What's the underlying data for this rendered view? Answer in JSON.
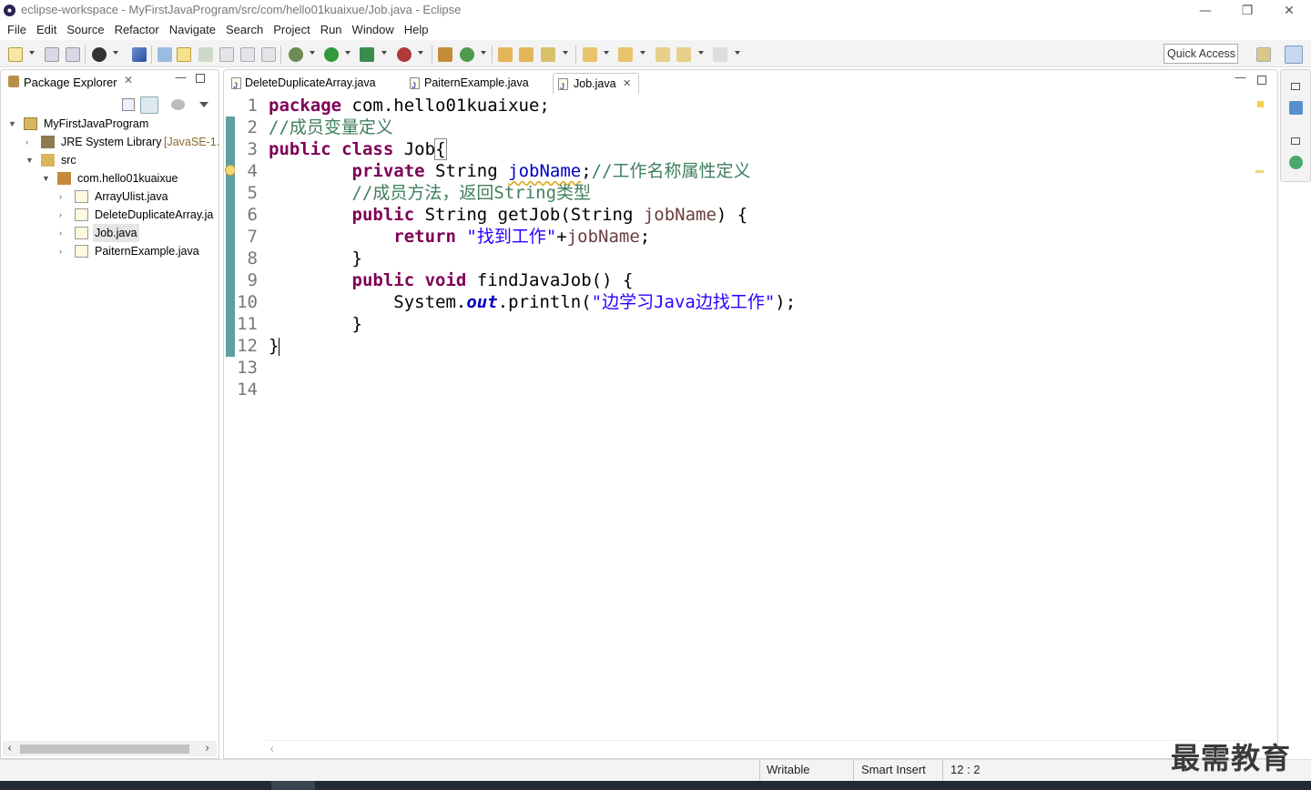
{
  "window": {
    "title": "eclipse-workspace - MyFirstJavaProgram/src/com/hello01kuaixue/Job.java - Eclipse",
    "minimize": "—",
    "restore": "❐",
    "close": "✕"
  },
  "menu": [
    "File",
    "Edit",
    "Source",
    "Refactor",
    "Navigate",
    "Search",
    "Project",
    "Run",
    "Window",
    "Help"
  ],
  "toolbar": {
    "quick_access": "Quick Access"
  },
  "package_explorer": {
    "title": "Package Explorer",
    "tree": [
      {
        "label": "MyFirstJavaProgram",
        "extra": ""
      },
      {
        "label": "JRE System Library",
        "extra": "[JavaSE-1."
      },
      {
        "label": "src",
        "extra": ""
      },
      {
        "label": "com.hello01kuaixue",
        "extra": ""
      },
      {
        "label": "ArrayUlist.java",
        "extra": ""
      },
      {
        "label": "DeleteDuplicateArray.ja",
        "extra": ""
      },
      {
        "label": "Job.java",
        "extra": ""
      },
      {
        "label": "PaiternExample.java",
        "extra": ""
      }
    ]
  },
  "editor": {
    "tabs": [
      {
        "label": "DeleteDuplicateArray.java",
        "active": false
      },
      {
        "label": "PaiternExample.java",
        "active": false
      },
      {
        "label": "Job.java",
        "active": true
      }
    ],
    "line_numbers": [
      "1",
      "2",
      "3",
      "4",
      "5",
      "6",
      "7",
      "8",
      "9",
      "10",
      "11",
      "12",
      "13",
      "14"
    ]
  },
  "status": {
    "writable": "Writable",
    "insert_mode": "Smart Insert",
    "position": "12 : 2"
  },
  "watermark": "最需教育"
}
